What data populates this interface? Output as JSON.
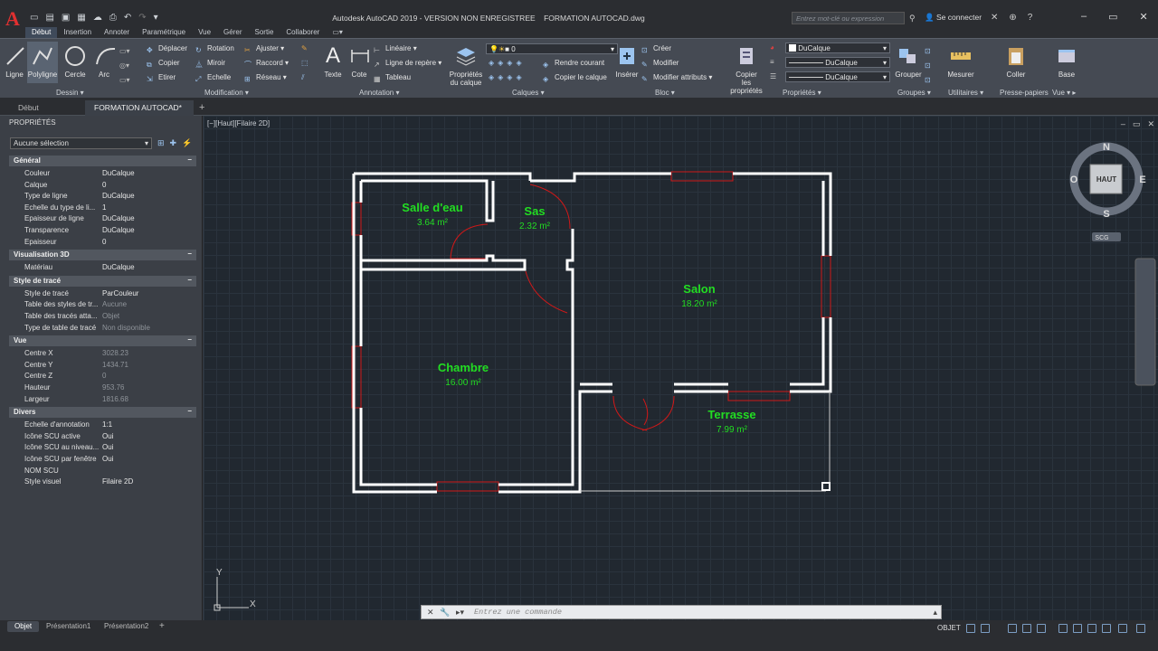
{
  "window": {
    "title": "Autodesk AutoCAD 2019 - VERSION NON ENREGISTREE    FORMATION AUTOCAD.dwg",
    "search_placeholder": "Entrez mot-clé ou expression",
    "signin": "Se connecter"
  },
  "menu": [
    "Début",
    "Insertion",
    "Annoter",
    "Paramétrique",
    "Vue",
    "Gérer",
    "Sortie",
    "Collaborer"
  ],
  "ribbon": {
    "dessin": {
      "title": "Dessin",
      "ligne": "Ligne",
      "polyligne": "Polyligne",
      "cercle": "Cercle",
      "arc": "Arc"
    },
    "modification": {
      "title": "Modification",
      "deplacer": "Déplacer",
      "rotation": "Rotation",
      "ajuster": "Ajuster",
      "copier": "Copier",
      "miroir": "Miroir",
      "raccord": "Raccord",
      "etirer": "Etirer",
      "echelle": "Echelle",
      "reseau": "Réseau"
    },
    "annotation": {
      "title": "Annotation",
      "texte": "Texte",
      "cote": "Cote",
      "lineaire": "Linéaire",
      "ligne_repere": "Ligne de repère",
      "tableau": "Tableau"
    },
    "calques": {
      "title": "Calques",
      "proprietes": "Propriétés",
      "du_calque": "du calque",
      "layer_value": "0",
      "rendre_courant": "Rendre courant",
      "copier_calque": "Copier le calque"
    },
    "bloc": {
      "title": "Bloc",
      "inserer": "Insérer",
      "creer": "Créer",
      "modifier": "Modifier",
      "modifier_attributs": "Modifier attributs"
    },
    "proprietes": {
      "title": "Propriétés",
      "copier": "Copier",
      "les_proprietes": "les propriétés",
      "couleur": "DuCalque",
      "type_ligne": "DuCalque",
      "epaisseur": "DuCalque"
    },
    "groupes": {
      "title": "Groupes",
      "grouper": "Grouper"
    },
    "utilitaires": {
      "title": "Utilitaires",
      "mesurer": "Mesurer"
    },
    "presse_papiers": {
      "title": "Presse-papiers",
      "coller": "Coller"
    },
    "vue": {
      "title": "Vue",
      "base": "Base"
    }
  },
  "doc_tabs": [
    "Début",
    "FORMATION AUTOCAD*"
  ],
  "properties": {
    "title": "PROPRIÉTÉS",
    "selection": "Aucune sélection",
    "sections": [
      {
        "name": "Général",
        "rows": [
          {
            "label": "Couleur",
            "value": "DuCalque"
          },
          {
            "label": "Calque",
            "value": "0"
          },
          {
            "label": "Type de ligne",
            "value": "DuCalque"
          },
          {
            "label": "Echelle du type de li...",
            "value": "1"
          },
          {
            "label": "Epaisseur de ligne",
            "value": "DuCalque"
          },
          {
            "label": "Transparence",
            "value": "DuCalque"
          },
          {
            "label": "Epaisseur",
            "value": "0"
          }
        ]
      },
      {
        "name": "Visualisation 3D",
        "rows": [
          {
            "label": "Matériau",
            "value": "DuCalque"
          }
        ]
      },
      {
        "name": "Style de tracé",
        "rows": [
          {
            "label": "Style de tracé",
            "value": "ParCouleur"
          },
          {
            "label": "Table des styles de tr...",
            "value": "Aucune"
          },
          {
            "label": "Table des tracés atta...",
            "value": "Objet"
          },
          {
            "label": "Type de table de tracé",
            "value": "Non disponible"
          }
        ]
      },
      {
        "name": "Vue",
        "rows": [
          {
            "label": "Centre X",
            "value": "3028.23"
          },
          {
            "label": "Centre Y",
            "value": "1434.71"
          },
          {
            "label": "Centre Z",
            "value": "0"
          },
          {
            "label": "Hauteur",
            "value": "953.76"
          },
          {
            "label": "Largeur",
            "value": "1816.68"
          }
        ]
      },
      {
        "name": "Divers",
        "rows": [
          {
            "label": "Echelle d'annotation",
            "value": "1:1"
          },
          {
            "label": "Icône SCU active",
            "value": "Oui"
          },
          {
            "label": "Icône SCU au niveau...",
            "value": "Oui"
          },
          {
            "label": "Icône SCU par fenêtre",
            "value": "Oui"
          },
          {
            "label": "NOM SCU",
            "value": ""
          },
          {
            "label": "Style visuel",
            "value": "Filaire 2D"
          }
        ]
      }
    ]
  },
  "viewport": {
    "label": "[−][Haut][Filaire 2D]",
    "rooms": [
      {
        "name": "Salle d'eau",
        "area": "3.64 m²"
      },
      {
        "name": "Sas",
        "area": "2.32 m²"
      },
      {
        "name": "Salon",
        "area": "18.20 m²"
      },
      {
        "name": "Chambre",
        "area": "16.00 m²"
      },
      {
        "name": "Terrasse",
        "area": "7.99 m²"
      }
    ],
    "viewcube": {
      "face": "HAUT",
      "n": "N",
      "s": "S",
      "e": "E",
      "o": "O",
      "wcs": "SCG"
    },
    "ucs": {
      "x": "X",
      "y": "Y"
    }
  },
  "command": {
    "placeholder": "Entrez une commande"
  },
  "layout_tabs": [
    "Objet",
    "Présentation1",
    "Présentation2"
  ],
  "status": {
    "model": "OBJET"
  },
  "colors": {
    "room_label": "#22dd22",
    "wall": "#ffffff",
    "window": "#d01818",
    "background": "#212830"
  }
}
